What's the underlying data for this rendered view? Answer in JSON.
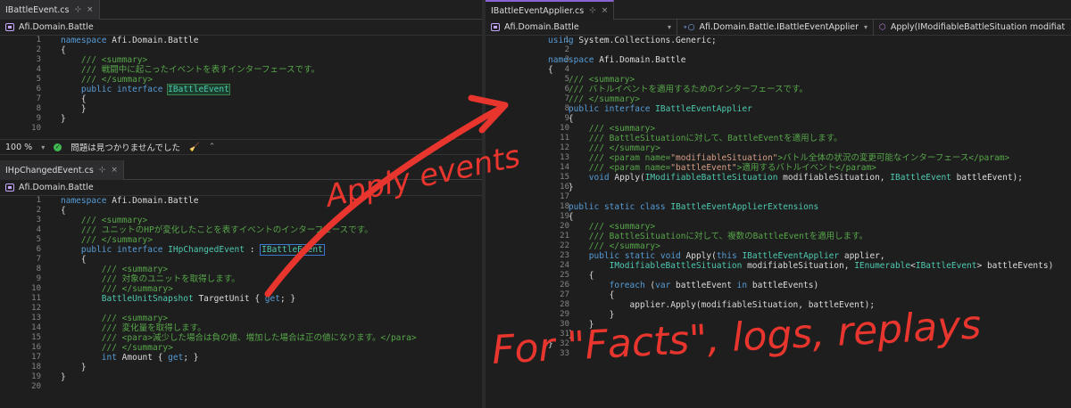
{
  "left_top": {
    "tab": {
      "label": "IBattleEvent.cs",
      "pin": "⊹",
      "close": "×"
    },
    "nav": {
      "label": "Afi.Domain.Battle"
    },
    "lines": [
      {
        "n": "1",
        "html": "<span class='kw'>namespace</span> Afi.Domain.Battle"
      },
      {
        "n": "2",
        "html": "{"
      },
      {
        "n": "3",
        "html": "    <span class='cm'>/// &lt;summary&gt;</span>"
      },
      {
        "n": "4",
        "html": "    <span class='cm'>/// 戦闘中に起こったイベントを表すインターフェースです。</span>"
      },
      {
        "n": "5",
        "html": "    <span class='cm'>/// &lt;/summary&gt;</span>"
      },
      {
        "n": "6",
        "html": "    <span class='kw'>public</span> <span class='kw'>interface</span> <span class='hl-sel'>IBattleEvent</span>"
      },
      {
        "n": "7",
        "html": "    {"
      },
      {
        "n": "8",
        "html": "    }"
      },
      {
        "n": "9",
        "html": "}"
      },
      {
        "n": "10",
        "html": ""
      }
    ]
  },
  "status": {
    "zoom": "100 %",
    "message": "問題は見つかりませんでした"
  },
  "left_bottom": {
    "tab": {
      "label": "IHpChangedEvent.cs",
      "pin": "⊹",
      "close": "×"
    },
    "nav": {
      "label": "Afi.Domain.Battle"
    },
    "lines": [
      {
        "n": "1",
        "html": "<span class='kw'>namespace</span> Afi.Domain.Battle"
      },
      {
        "n": "2",
        "html": "{"
      },
      {
        "n": "3",
        "html": "    <span class='cm'>/// &lt;summary&gt;</span>"
      },
      {
        "n": "4",
        "html": "    <span class='cm'>/// ユニットのHPが変化したことを表すイベントのインターフェースです。</span>"
      },
      {
        "n": "5",
        "html": "    <span class='cm'>/// &lt;/summary&gt;</span>"
      },
      {
        "n": "6",
        "html": "    <span class='kw'>public</span> <span class='kw'>interface</span> <span class='ty'>IHpChangedEvent</span> : <span class='hl-box'>IBattleEvent</span>"
      },
      {
        "n": "7",
        "html": "    {"
      },
      {
        "n": "8",
        "html": "        <span class='cm'>/// &lt;summary&gt;</span>"
      },
      {
        "n": "9",
        "html": "        <span class='cm'>/// 対象のユニットを取得します。</span>"
      },
      {
        "n": "10",
        "html": "        <span class='cm'>/// &lt;/summary&gt;</span>"
      },
      {
        "n": "11",
        "html": "        <span class='ty'>BattleUnitSnapshot</span> TargetUnit { <span class='kw'>get</span>; }"
      },
      {
        "n": "12",
        "html": ""
      },
      {
        "n": "13",
        "html": "        <span class='cm'>/// &lt;summary&gt;</span>"
      },
      {
        "n": "14",
        "html": "        <span class='cm'>/// 変化量を取得します。</span>"
      },
      {
        "n": "15",
        "html": "        <span class='cm'>/// &lt;para&gt;減少した場合は負の値、増加した場合は正の値になります。&lt;/para&gt;</span>"
      },
      {
        "n": "16",
        "html": "        <span class='cm'>/// &lt;/summary&gt;</span>"
      },
      {
        "n": "17",
        "html": "        <span class='kw'>int</span> Amount { <span class='kw'>get</span>; }"
      },
      {
        "n": "18",
        "html": "    }"
      },
      {
        "n": "19",
        "html": "}"
      },
      {
        "n": "20",
        "html": ""
      }
    ]
  },
  "right": {
    "tab": {
      "label": "IBattleEventApplier.cs",
      "pin": "⊹",
      "close": "×"
    },
    "nav": {
      "project": "Afi.Domain.Battle",
      "type": "Afi.Domain.Battle.IBattleEventApplier",
      "member": "Apply(IModifiableBattleSituation modifiat"
    },
    "lines": [
      {
        "n": "1",
        "html": "<span class='kw'>using</span> System.Collections.Generic;"
      },
      {
        "n": "2",
        "html": ""
      },
      {
        "n": "3",
        "html": "<span class='kw'>namespace</span> Afi.Domain.Battle"
      },
      {
        "n": "4",
        "html": "{"
      },
      {
        "n": "5",
        "html": "    <span class='cm'>/// &lt;summary&gt;</span>"
      },
      {
        "n": "6",
        "html": "    <span class='cm'>/// バトルイベントを適用するためのインターフェースです。</span>"
      },
      {
        "n": "7",
        "html": "    <span class='cm'>/// &lt;/summary&gt;</span>"
      },
      {
        "n": "8",
        "html": "    <span class='kw'>public</span> <span class='kw'>interface</span> <span class='ty'>IBattleEventApplier</span>"
      },
      {
        "n": "9",
        "html": "    {"
      },
      {
        "n": "10",
        "html": "        <span class='cm'>/// &lt;summary&gt;</span>"
      },
      {
        "n": "11",
        "html": "        <span class='cm'>/// BattleSituationに対して、BattleEventを適用します。</span>"
      },
      {
        "n": "12",
        "html": "        <span class='cm'>/// &lt;/summary&gt;</span>"
      },
      {
        "n": "13",
        "html": "        <span class='cm'>/// &lt;param name=<span class='st'>\"modifiableSituation\"</span>&gt;バトル全体の状況の変更可能なインターフェース&lt;/param&gt;</span>"
      },
      {
        "n": "14",
        "html": "        <span class='cm'>/// &lt;param name=<span class='st'>\"battleEvent\"</span>&gt;適用するバトルイベント&lt;/param&gt;</span>"
      },
      {
        "n": "15",
        "html": "        <span class='kw'>void</span> Apply(<span class='ty'>IModifiableBattleSituation</span> modifiableSituation, <span class='ty'>IBattleEvent</span> battleEvent);"
      },
      {
        "n": "16",
        "html": "    }"
      },
      {
        "n": "17",
        "html": ""
      },
      {
        "n": "18",
        "html": "    <span class='kw'>public</span> <span class='kw'>static</span> <span class='kw'>class</span> <span class='ty'>IBattleEventApplierExtensions</span>"
      },
      {
        "n": "19",
        "html": "    {"
      },
      {
        "n": "20",
        "html": "        <span class='cm'>/// &lt;summary&gt;</span>"
      },
      {
        "n": "21",
        "html": "        <span class='cm'>/// BattleSituationに対して、複数のBattleEventを適用します。</span>"
      },
      {
        "n": "22",
        "html": "        <span class='cm'>/// &lt;/summary&gt;</span>"
      },
      {
        "n": "23",
        "html": "        <span class='kw'>public</span> <span class='kw'>static</span> <span class='kw'>void</span> Apply(<span class='kw'>this</span> <span class='ty'>IBattleEventApplier</span> applier,"
      },
      {
        "n": "24",
        "html": "            <span class='ty'>IModifiableBattleSituation</span> modifiableSituation, <span class='ty'>IEnumerable</span>&lt;<span class='ty'>IBattleEvent</span>&gt; battleEvents)"
      },
      {
        "n": "25",
        "html": "        {"
      },
      {
        "n": "26",
        "html": "            <span class='kw'>foreach</span> (<span class='kw'>var</span> battleEvent <span class='kw'>in</span> battleEvents)"
      },
      {
        "n": "27",
        "html": "            {"
      },
      {
        "n": "28",
        "html": "                applier.Apply(modifiableSituation, battleEvent);"
      },
      {
        "n": "29",
        "html": "            }"
      },
      {
        "n": "30",
        "html": "        }"
      },
      {
        "n": "31",
        "html": "    }"
      },
      {
        "n": "32",
        "html": "}"
      },
      {
        "n": "33",
        "html": ""
      }
    ]
  },
  "annotations": {
    "apply_events": "Apply events",
    "facts": "For \"Facts\", logs, replays"
  },
  "colors": {
    "accent": "#8a63d2",
    "annotation": "#e8352e"
  }
}
